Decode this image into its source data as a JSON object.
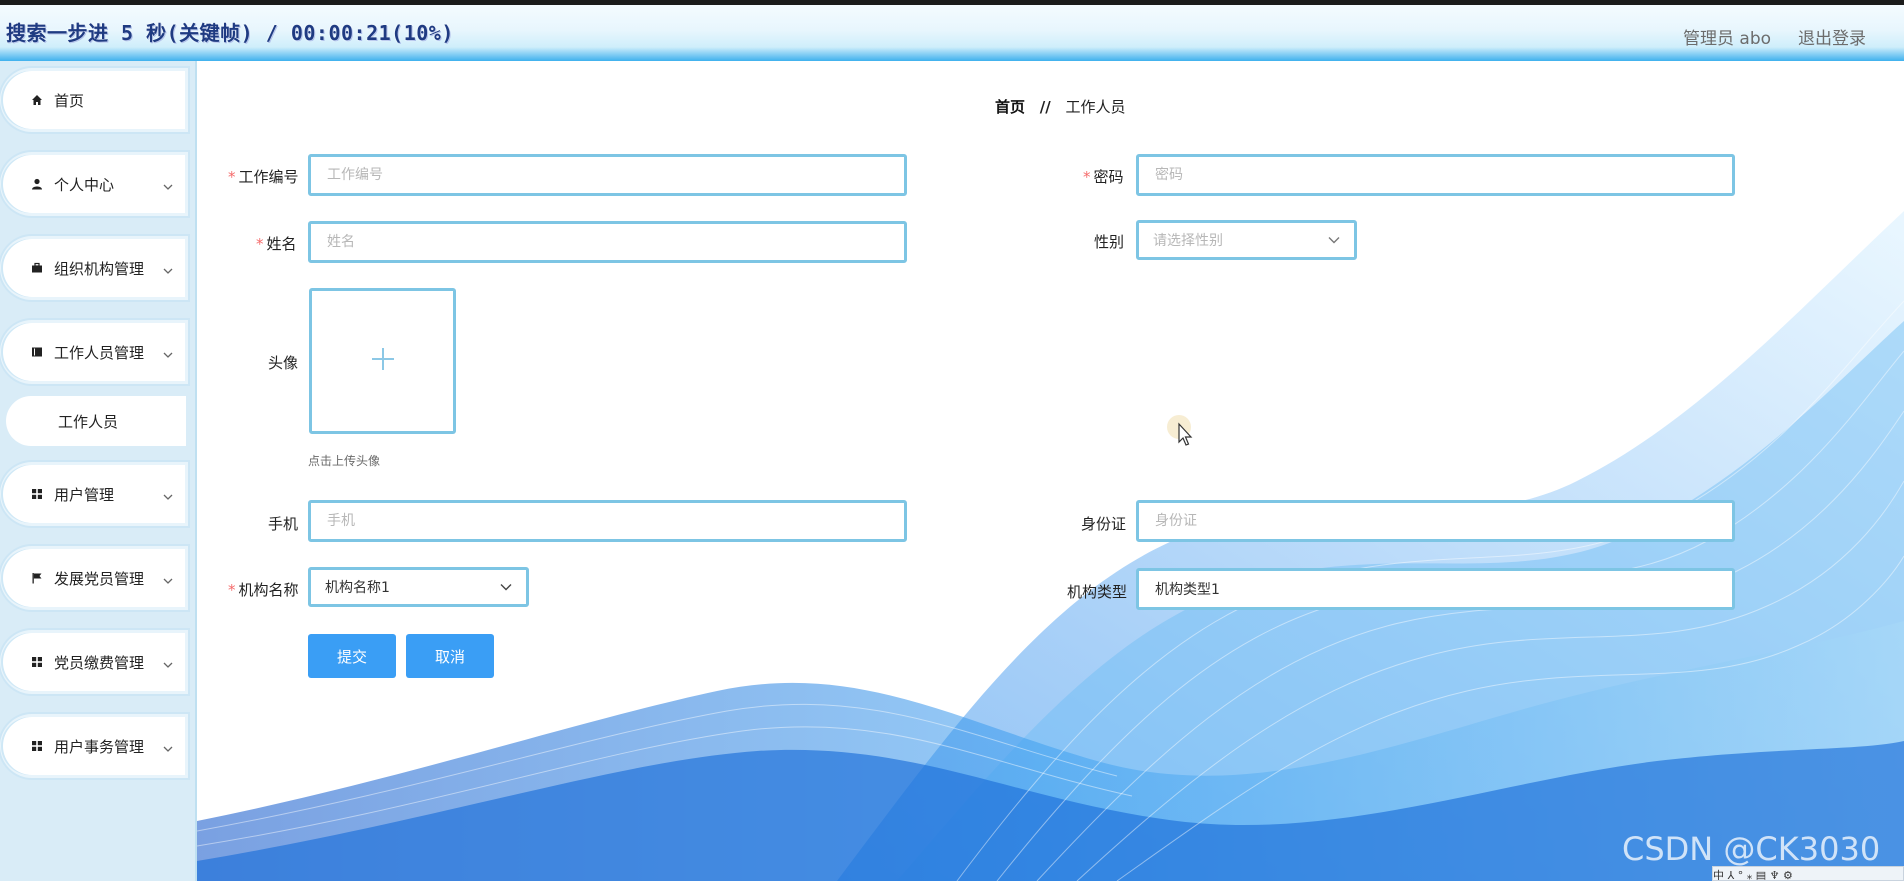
{
  "header": {
    "title": "搜索一步进 5 秒(关键帧) / 00:00:21(10%)",
    "admin": "管理员 abo",
    "logout": "退出登录"
  },
  "sidebar": {
    "items": [
      {
        "label": "首页",
        "icon": "home-icon"
      },
      {
        "label": "个人中心",
        "icon": "user-icon"
      },
      {
        "label": "组织机构管理",
        "icon": "briefcase-icon"
      },
      {
        "label": "工作人员管理",
        "icon": "book-icon"
      },
      {
        "label": "用户管理",
        "icon": "grid-icon"
      },
      {
        "label": "发展党员管理",
        "icon": "flag-icon"
      },
      {
        "label": "党员缴费管理",
        "icon": "grid-icon"
      },
      {
        "label": "用户事务管理",
        "icon": "grid-icon"
      }
    ],
    "sub_item": "工作人员"
  },
  "breadcrumb": {
    "home": "首页",
    "separator": "//",
    "current": "工作人员"
  },
  "form": {
    "work_no": {
      "label": "工作编号",
      "placeholder": "工作编号",
      "value": ""
    },
    "password": {
      "label": "密码",
      "placeholder": "密码",
      "value": ""
    },
    "name": {
      "label": "姓名",
      "placeholder": "姓名",
      "value": ""
    },
    "gender": {
      "label": "性别",
      "placeholder": "请选择性别"
    },
    "avatar": {
      "label": "头像",
      "tip": "点击上传头像"
    },
    "phone": {
      "label": "手机",
      "placeholder": "手机",
      "value": ""
    },
    "id_card": {
      "label": "身份证",
      "placeholder": "身份证",
      "value": ""
    },
    "org_name": {
      "label": "机构名称",
      "value": "机构名称1"
    },
    "org_type": {
      "label": "机构类型",
      "value": "机构类型1"
    },
    "submit": "提交",
    "cancel": "取消"
  },
  "watermark": "CSDN @CK3030",
  "tray": "中 ⅄ ° ⁎ ▤ ♆ ⚙",
  "colors": {
    "accent": "#3a9ef5",
    "input_border": "#7dc5e4",
    "required": "#f56c6c"
  }
}
